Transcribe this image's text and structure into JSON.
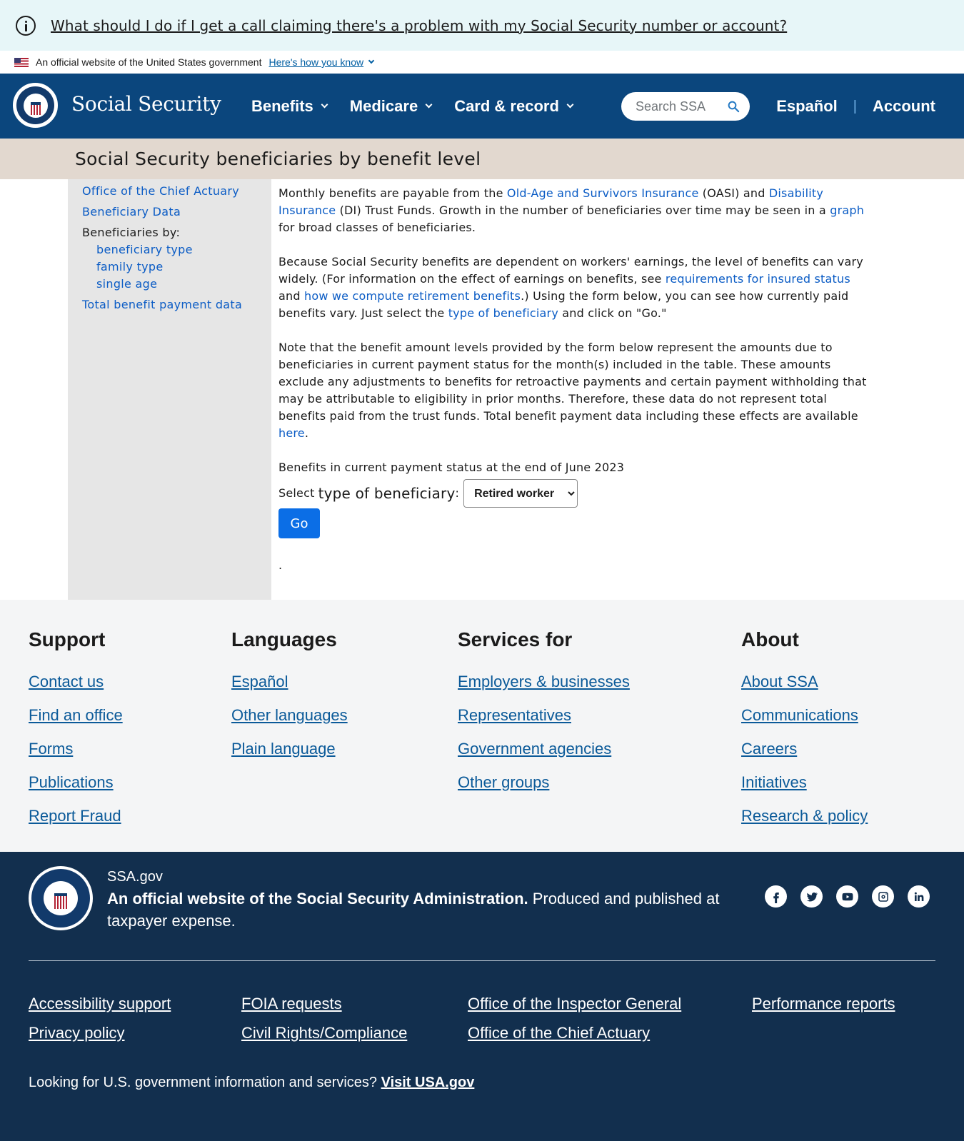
{
  "alert": {
    "text": "What should I do if I get a call claiming there's a problem with my Social Security number or account?"
  },
  "gov_banner": {
    "text": "An official website of the United States government",
    "link": "Here's how you know"
  },
  "header": {
    "brand": "Social Security",
    "nav": [
      "Benefits",
      "Medicare",
      "Card & record"
    ],
    "search_placeholder": "Search SSA",
    "espanol": "Español",
    "separator": "|",
    "account": "Account"
  },
  "page_title": "Social Security beneficiaries by benefit level",
  "sidebar": {
    "item1": "Office of the Chief Actuary",
    "item2": "Beneficiary Data",
    "by_label": "Beneficiaries by:",
    "sub1": "beneficiary type",
    "sub2": "family type",
    "sub3": "single age",
    "item3": "Total benefit payment data"
  },
  "content": {
    "p1": {
      "t1": "Monthly benefits are payable from the ",
      "l1": "Old-Age and Survivors Insurance",
      "t2": " (OASI) and ",
      "l2": "Disability Insurance",
      "t3": " (DI) Trust Funds. Growth in the number of beneficiaries over time may be seen in a ",
      "l3": "graph",
      "t4": " for broad classes of beneficiaries."
    },
    "p2": {
      "t1": "Because Social Security benefits are dependent on workers' earnings, the level of benefits can vary widely. (For information on the effect of earnings on benefits, see ",
      "l1": "requirements for insured status",
      "t2": " and ",
      "l2": "how we compute retirement benefits",
      "t3": ".) Using the form below, you can see how currently paid benefits vary. Just select the ",
      "l3": "type of beneficiary",
      "t4": " and click on \"Go.\""
    },
    "p3": {
      "t1": "Note that the benefit amount levels provided by the form below represent the amounts due to beneficiaries in current payment status for the month(s) included in the table. These amounts exclude any adjustments to benefits for retroactive payments and certain payment withholding that may be attributable to eligibility in prior months. Therefore, these data do not represent total benefits paid from the trust funds. Total benefit payment data including these effects are available ",
      "l1": "here",
      "t2": "."
    },
    "status": "Benefits in current payment status at the end of June 2023",
    "select_label": "Select",
    "select_label_big": "type of beneficiary",
    "colon": ":",
    "select_value": "Retired worker",
    "go": "Go",
    "trailing": "."
  },
  "footer": {
    "support": {
      "title": "Support",
      "links": [
        "Contact us",
        "Find an office",
        "Forms",
        "Publications",
        "Report Fraud"
      ]
    },
    "languages": {
      "title": "Languages",
      "links": [
        "Español",
        "Other languages",
        "Plain language"
      ]
    },
    "services": {
      "title": "Services for",
      "links": [
        "Employers & businesses",
        "Representatives",
        "Government agencies",
        "Other groups"
      ]
    },
    "about": {
      "title": "About",
      "links": [
        "About SSA",
        "Communications",
        "Careers",
        "Initiatives",
        "Research & policy"
      ]
    }
  },
  "bottom": {
    "site": "SSA.gov",
    "official_bold": "An official website of the Social Security Administration.",
    "official_rest": " Produced and published at taxpayer expense.",
    "legal": [
      "Accessibility support",
      "Privacy policy",
      "FOIA requests",
      "Civil Rights/Compliance",
      "Office of the Inspector General",
      "Office of the Chief Actuary",
      "Performance reports"
    ],
    "usa_text": "Looking for U.S. government information and services? ",
    "usa_link": "Visit USA.gov"
  },
  "colors": {
    "header": "#0b467d",
    "footer": "#122f4e",
    "link": "#0b5cc5",
    "go_button": "#0b6ee6",
    "title_band": "#e2d8cf"
  }
}
